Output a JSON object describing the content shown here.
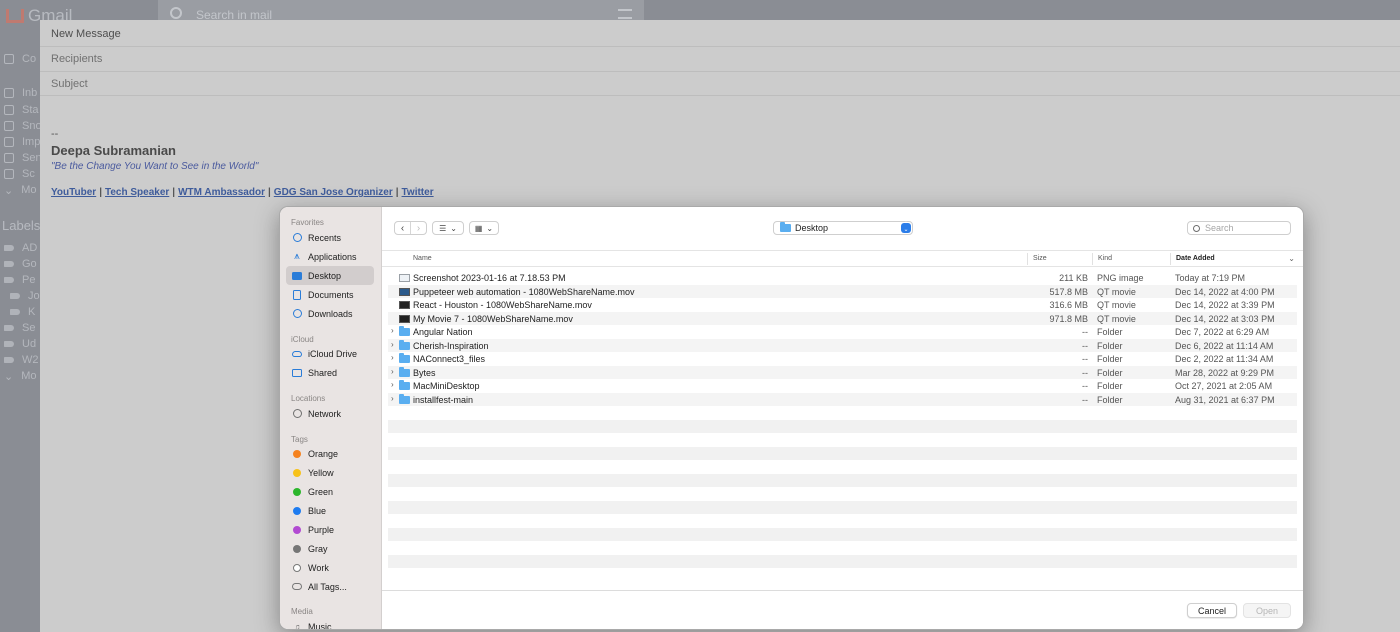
{
  "gmail": {
    "logo": "Gmail",
    "search_placeholder": "Search in mail",
    "sidebar_items": [
      "Co",
      "Inb",
      "Sta",
      "Sno",
      "Imp",
      "Sen",
      "Sc",
      "Mo"
    ],
    "labels_title": "Labels",
    "label_items": [
      "AD",
      "Go",
      "Pe",
      "Jo",
      "K",
      "Se",
      "Ud",
      "W2",
      "Mo"
    ]
  },
  "compose": {
    "title": "New Message",
    "recipients_placeholder": "Recipients",
    "subject_placeholder": "Subject",
    "signature": {
      "dashes": "--",
      "name": "Deepa Subramanian",
      "quote": "\"Be the Change You Want to See in the World\"",
      "links": [
        "YouTuber",
        "Tech Speaker",
        "WTM Ambassador",
        "GDG San Jose Organizer",
        "Twitter"
      ],
      "separator": "|"
    }
  },
  "dialog": {
    "sidebar": {
      "favorites_title": "Favorites",
      "favorites": [
        {
          "label": "Recents",
          "icon": "clock-icon"
        },
        {
          "label": "Applications",
          "icon": "applications-icon"
        },
        {
          "label": "Desktop",
          "icon": "desktop-icon",
          "selected": true
        },
        {
          "label": "Documents",
          "icon": "document-icon"
        },
        {
          "label": "Downloads",
          "icon": "downloads-icon"
        }
      ],
      "icloud_title": "iCloud",
      "icloud": [
        {
          "label": "iCloud Drive",
          "icon": "cloud-icon"
        },
        {
          "label": "Shared",
          "icon": "shared-folder-icon"
        }
      ],
      "locations_title": "Locations",
      "locations": [
        {
          "label": "Network",
          "icon": "globe-icon"
        }
      ],
      "tags_title": "Tags",
      "tags": [
        {
          "label": "Orange",
          "color": "#f5821f"
        },
        {
          "label": "Yellow",
          "color": "#f7c21a"
        },
        {
          "label": "Green",
          "color": "#2cb62c"
        },
        {
          "label": "Blue",
          "color": "#1f7cf0"
        },
        {
          "label": "Purple",
          "color": "#b24ad2"
        },
        {
          "label": "Gray",
          "color": "#767676"
        },
        {
          "label": "Work",
          "color": "hollow"
        },
        {
          "label": "All Tags...",
          "color": "all"
        }
      ],
      "media_title": "Media",
      "media": [
        {
          "label": "Music",
          "icon": "music-icon"
        }
      ]
    },
    "toolbar": {
      "back": "‹",
      "forward": "›",
      "location": "Desktop",
      "search_placeholder": "Search"
    },
    "columns": {
      "name": "Name",
      "size": "Size",
      "kind": "Kind",
      "date": "Date Added"
    },
    "files": [
      {
        "name": "Screenshot 2023-01-16 at 7.18.53 PM",
        "size": "211 KB",
        "kind": "PNG image",
        "date": "Today at 7:19 PM",
        "type": "png"
      },
      {
        "name": "Puppeteer web automation - 1080WebShareName.mov",
        "size": "517.8 MB",
        "kind": "QT movie",
        "date": "Dec 14, 2022 at 4:00 PM",
        "type": "mov-blue"
      },
      {
        "name": "React - Houston - 1080WebShareName.mov",
        "size": "316.6 MB",
        "kind": "QT movie",
        "date": "Dec 14, 2022 at 3:39 PM",
        "type": "mov"
      },
      {
        "name": "My Movie 7 - 1080WebShareName.mov",
        "size": "971.8 MB",
        "kind": "QT movie",
        "date": "Dec 14, 2022 at 3:03 PM",
        "type": "mov"
      },
      {
        "name": "Angular Nation",
        "size": "--",
        "kind": "Folder",
        "date": "Dec 7, 2022 at 6:29 AM",
        "type": "folder"
      },
      {
        "name": "Cherish-Inspiration",
        "size": "--",
        "kind": "Folder",
        "date": "Dec 6, 2022 at 11:14 AM",
        "type": "folder"
      },
      {
        "name": "NAConnect3_files",
        "size": "--",
        "kind": "Folder",
        "date": "Dec 2, 2022 at 11:34 AM",
        "type": "folder"
      },
      {
        "name": "Bytes",
        "size": "--",
        "kind": "Folder",
        "date": "Mar 28, 2022 at 9:29 PM",
        "type": "folder"
      },
      {
        "name": "MacMiniDesktop",
        "size": "--",
        "kind": "Folder",
        "date": "Oct 27, 2021 at 2:05 AM",
        "type": "folder"
      },
      {
        "name": "installfest-main",
        "size": "--",
        "kind": "Folder",
        "date": "Aug 31, 2021 at 6:37 PM",
        "type": "folder"
      }
    ],
    "buttons": {
      "cancel": "Cancel",
      "open": "Open"
    }
  }
}
